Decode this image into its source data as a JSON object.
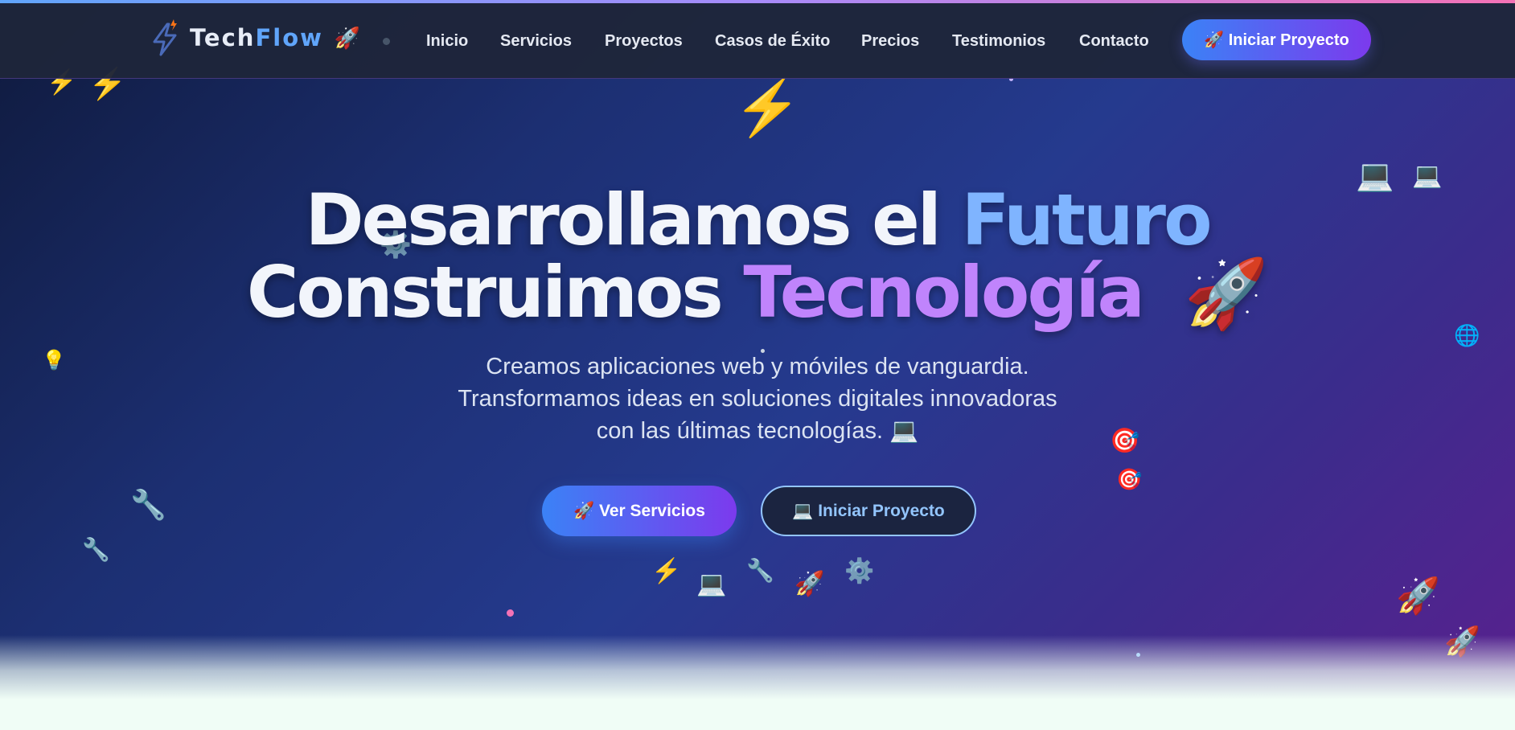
{
  "brand": {
    "name_part1": "Tech",
    "name_part2": "Flow",
    "emoji": "🚀",
    "logo_icon": "lightning-bolt-icon"
  },
  "nav": {
    "links": [
      "Inicio",
      "Servicios",
      "Proyectos",
      "Casos de Éxito",
      "Precios",
      "Testimonios",
      "Contacto"
    ],
    "cta_label": "🚀 Iniciar Proyecto"
  },
  "hero": {
    "headline_line1_prefix": "Desarrollamos el ",
    "headline_line1_highlight": "Futuro",
    "headline_line2_prefix": "Construimos ",
    "headline_line2_highlight": "Tecnología",
    "headline_emoji": "🚀",
    "subtitle_line1": "Creamos aplicaciones web y móviles de vanguardia.",
    "subtitle_line2": "Transformamos ideas en soluciones digitales innovadoras",
    "subtitle_line3": "con las últimas tecnologías. 💻",
    "primary_button": "🚀 Ver Servicios",
    "secondary_button": "💻 Iniciar Proyecto"
  },
  "decorations": [
    {
      "name": "lightning-icon",
      "glyph": "⚡"
    },
    {
      "name": "laptop-icon",
      "glyph": "💻"
    },
    {
      "name": "gear-icon",
      "glyph": "⚙️"
    },
    {
      "name": "rocket-icon",
      "glyph": "🚀"
    },
    {
      "name": "globe-icon",
      "glyph": "🌐"
    },
    {
      "name": "lightbulb-icon",
      "glyph": "💡"
    },
    {
      "name": "target-icon",
      "glyph": "🎯"
    },
    {
      "name": "wrench-icon",
      "glyph": "🔧"
    }
  ],
  "colors": {
    "accent_blue": "#3b82f6",
    "accent_purple": "#7c3aed",
    "highlight_blue": "#7fb4ff",
    "highlight_purple": "#c084fc",
    "nav_bg": "#1e253a",
    "hero_bg_start": "#0f1a3d",
    "hero_bg_end": "#58218f"
  }
}
